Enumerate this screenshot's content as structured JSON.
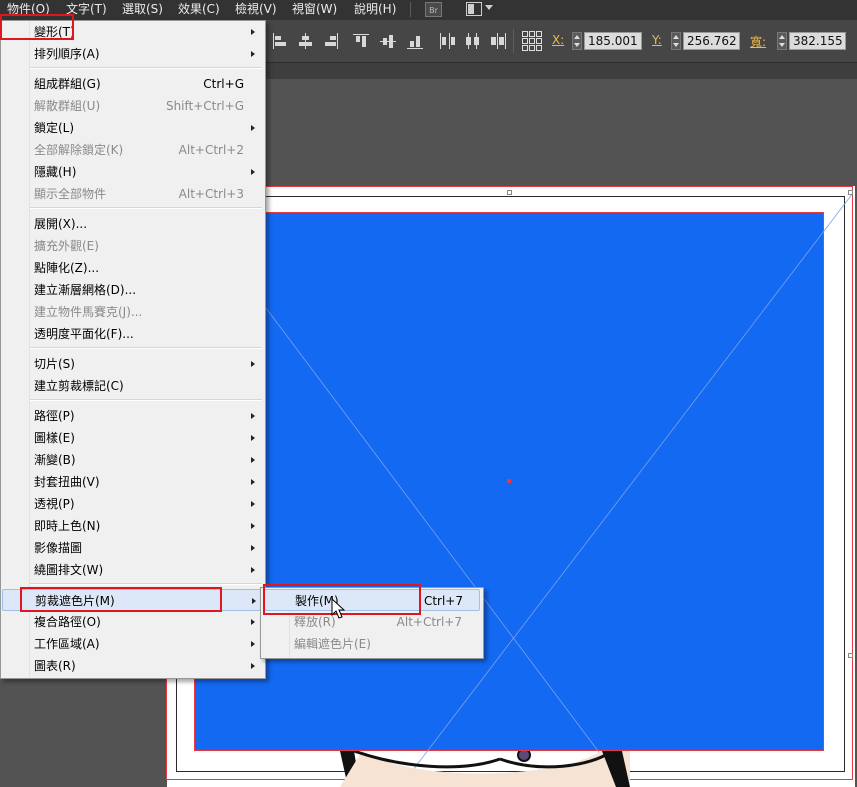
{
  "menubar": {
    "items": [
      "物件(O)",
      "文字(T)",
      "選取(S)",
      "效果(C)",
      "檢視(V)",
      "視窗(W)",
      "說明(H)"
    ],
    "bridge_label": "Br"
  },
  "controlbar": {
    "x_label": "X:",
    "x_value": "185.001",
    "y_label": "Y:",
    "y_value": "256.762",
    "w_label": "寬:",
    "w_value": "382.155"
  },
  "object_menu": {
    "items": [
      {
        "label": "變形(T)",
        "shortcut": "",
        "submenu": true,
        "disabled": false
      },
      {
        "label": "排列順序(A)",
        "shortcut": "",
        "submenu": true,
        "disabled": false
      },
      {
        "label": "組成群組(G)",
        "shortcut": "Ctrl+G",
        "submenu": false,
        "disabled": false
      },
      {
        "label": "解散群組(U)",
        "shortcut": "Shift+Ctrl+G",
        "submenu": false,
        "disabled": true
      },
      {
        "label": "鎖定(L)",
        "shortcut": "",
        "submenu": true,
        "disabled": false
      },
      {
        "label": "全部解除鎖定(K)",
        "shortcut": "Alt+Ctrl+2",
        "submenu": false,
        "disabled": true
      },
      {
        "label": "隱藏(H)",
        "shortcut": "",
        "submenu": true,
        "disabled": false
      },
      {
        "label": "顯示全部物件",
        "shortcut": "Alt+Ctrl+3",
        "submenu": false,
        "disabled": true
      },
      {
        "label": "展開(X)...",
        "shortcut": "",
        "submenu": false,
        "disabled": false
      },
      {
        "label": "擴充外觀(E)",
        "shortcut": "",
        "submenu": false,
        "disabled": true
      },
      {
        "label": "點陣化(Z)...",
        "shortcut": "",
        "submenu": false,
        "disabled": false
      },
      {
        "label": "建立漸層網格(D)...",
        "shortcut": "",
        "submenu": false,
        "disabled": false
      },
      {
        "label": "建立物件馬賽克(J)...",
        "shortcut": "",
        "submenu": false,
        "disabled": true
      },
      {
        "label": "透明度平面化(F)...",
        "shortcut": "",
        "submenu": false,
        "disabled": false
      },
      {
        "label": "切片(S)",
        "shortcut": "",
        "submenu": true,
        "disabled": false
      },
      {
        "label": "建立剪裁標記(C)",
        "shortcut": "",
        "submenu": false,
        "disabled": false
      },
      {
        "label": "路徑(P)",
        "shortcut": "",
        "submenu": true,
        "disabled": false
      },
      {
        "label": "圖樣(E)",
        "shortcut": "",
        "submenu": true,
        "disabled": false
      },
      {
        "label": "漸變(B)",
        "shortcut": "",
        "submenu": true,
        "disabled": false
      },
      {
        "label": "封套扭曲(V)",
        "shortcut": "",
        "submenu": true,
        "disabled": false
      },
      {
        "label": "透視(P)",
        "shortcut": "",
        "submenu": true,
        "disabled": false
      },
      {
        "label": "即時上色(N)",
        "shortcut": "",
        "submenu": true,
        "disabled": false
      },
      {
        "label": "影像描圖",
        "shortcut": "",
        "submenu": true,
        "disabled": false
      },
      {
        "label": "繞圖排文(W)",
        "shortcut": "",
        "submenu": true,
        "disabled": false
      },
      {
        "label": "剪裁遮色片(M)",
        "shortcut": "",
        "submenu": true,
        "disabled": false,
        "highlighted": true
      },
      {
        "label": "複合路徑(O)",
        "shortcut": "",
        "submenu": true,
        "disabled": false
      },
      {
        "label": "工作區域(A)",
        "shortcut": "",
        "submenu": true,
        "disabled": false
      },
      {
        "label": "圖表(R)",
        "shortcut": "",
        "submenu": true,
        "disabled": false
      }
    ]
  },
  "clipping_mask_submenu": {
    "items": [
      {
        "label": "製作(M)",
        "shortcut": "Ctrl+7",
        "disabled": false,
        "highlighted": true
      },
      {
        "label": "釋放(R)",
        "shortcut": "Alt+Ctrl+7",
        "disabled": true
      },
      {
        "label": "編輯遮色片(E)",
        "shortcut": "",
        "disabled": true
      }
    ]
  },
  "colors": {
    "menubar_bg": "#333333",
    "controlbar_bg": "#464646",
    "canvas_bg": "#535353",
    "shape_fill": "#1469f2",
    "selection_red": "#e8393f",
    "annotation_red": "#e0151d",
    "field_label_orange": "#ecb84a"
  }
}
